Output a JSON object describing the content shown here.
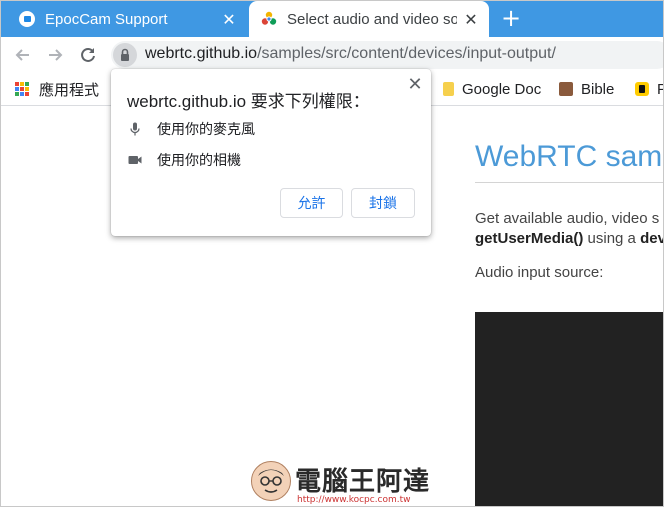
{
  "browser": {
    "tabs": [
      {
        "title": "EpocCam Support",
        "active": false,
        "icon": "epoccam-icon"
      },
      {
        "title": "Select audio and video so",
        "active": true,
        "icon": "webrtc-icon"
      }
    ],
    "new_tab_symbol": "+",
    "close_symbol": "✕",
    "address": {
      "domain": "webrtc.github.io",
      "path": "/samples/src/content/devices/input-output/"
    },
    "accent_color": "#3f98e3"
  },
  "bookmarks": [
    {
      "label": "應用程式",
      "icon": "apps-grid-icon"
    },
    {
      "label": "Google Doc",
      "icon": "folder-icon"
    },
    {
      "label": "Bible",
      "icon": "book-icon"
    },
    {
      "label": "P",
      "icon": "bookmark-icon"
    }
  ],
  "page": {
    "heading": "WebRTC sam",
    "intro_line1": "Get available audio, video s",
    "intro_line2_bold": "getUserMedia()",
    "intro_line2_mid": " using a ",
    "intro_line2_end": "dev",
    "audio_input_label": "Audio input source:"
  },
  "permission_dialog": {
    "title": "webrtc.github.io 要求下列權限：",
    "permissions": [
      {
        "label": "使用你的麥克風",
        "icon": "microphone-icon"
      },
      {
        "label": "使用你的相機",
        "icon": "camera-icon"
      }
    ],
    "allow_label": "允許",
    "block_label": "封鎖",
    "close_symbol": "✕"
  },
  "watermark": {
    "text": "電腦王阿達",
    "url": "http://www.kocpc.com.tw"
  }
}
